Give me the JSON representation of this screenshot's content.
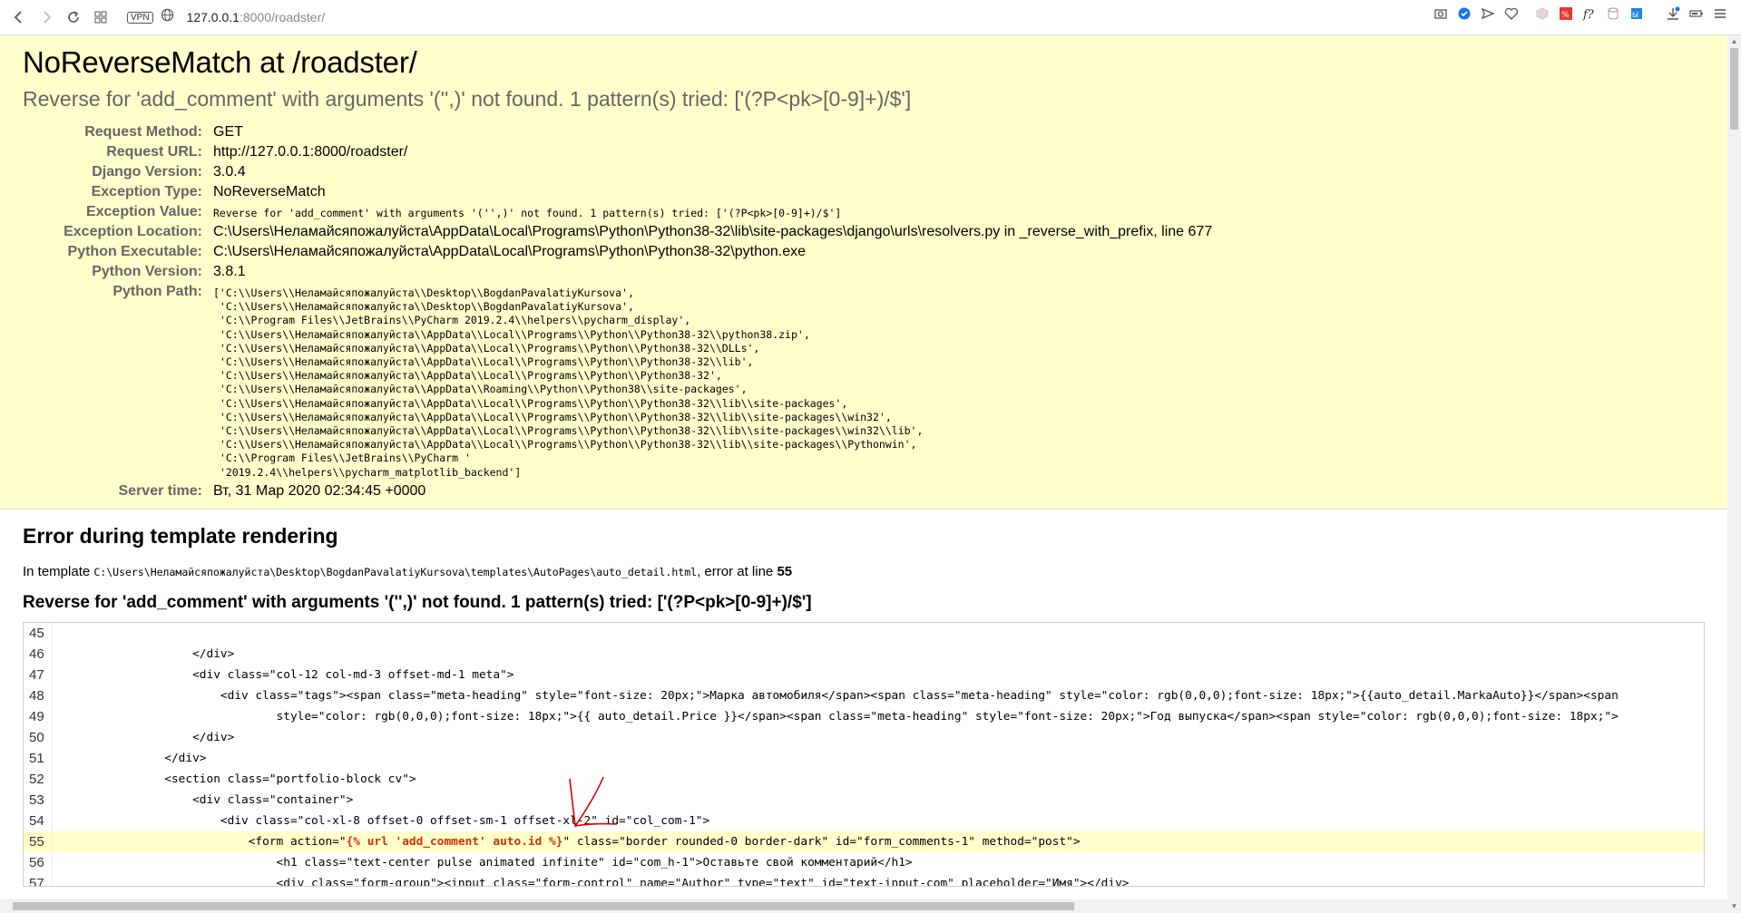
{
  "browser": {
    "url_host": "127.0.0.1",
    "url_rest": ":8000/roadster/",
    "vpn_label": "VPN"
  },
  "error": {
    "title": "NoReverseMatch at /roadster/",
    "subtitle": "Reverse for 'add_comment' with arguments '('',)' not found. 1 pattern(s) tried: ['(?P<pk>[0-9]+)/$']",
    "meta": [
      {
        "label": "Request Method:",
        "value": "GET"
      },
      {
        "label": "Request URL:",
        "value": "http://127.0.0.1:8000/roadster/"
      },
      {
        "label": "Django Version:",
        "value": "3.0.4"
      },
      {
        "label": "Exception Type:",
        "value": "NoReverseMatch"
      },
      {
        "label": "Exception Value:",
        "value": "Reverse for 'add_comment' with arguments '('',)' not found. 1 pattern(s) tried: ['(?P<pk>[0-9]+)/$']"
      },
      {
        "label": "Exception Location:",
        "value": "C:\\Users\\Неламайсяпожалуйста\\AppData\\Local\\Programs\\Python\\Python38-32\\lib\\site-packages\\django\\urls\\resolvers.py in _reverse_with_prefix, line 677"
      },
      {
        "label": "Python Executable:",
        "value": "C:\\Users\\Неламайсяпожалуйста\\AppData\\Local\\Programs\\Python\\Python38-32\\python.exe"
      },
      {
        "label": "Python Version:",
        "value": "3.8.1"
      },
      {
        "label": "Python Path:",
        "value": "['C:\\\\Users\\\\Неламайсяпожалуйста\\\\Desktop\\\\BogdanPavalatiyKursova',\n 'C:\\\\Users\\\\Неламайсяпожалуйста\\\\Desktop\\\\BogdanPavalatiyKursova',\n 'C:\\\\Program Files\\\\JetBrains\\\\PyCharm 2019.2.4\\\\helpers\\\\pycharm_display',\n 'C:\\\\Users\\\\Неламайсяпожалуйста\\\\AppData\\\\Local\\\\Programs\\\\Python\\\\Python38-32\\\\python38.zip',\n 'C:\\\\Users\\\\Неламайсяпожалуйста\\\\AppData\\\\Local\\\\Programs\\\\Python\\\\Python38-32\\\\DLLs',\n 'C:\\\\Users\\\\Неламайсяпожалуйста\\\\AppData\\\\Local\\\\Programs\\\\Python\\\\Python38-32\\\\lib',\n 'C:\\\\Users\\\\Неламайсяпожалуйста\\\\AppData\\\\Local\\\\Programs\\\\Python\\\\Python38-32',\n 'C:\\\\Users\\\\Неламайсяпожалуйста\\\\AppData\\\\Roaming\\\\Python\\\\Python38\\\\site-packages',\n 'C:\\\\Users\\\\Неламайсяпожалуйста\\\\AppData\\\\Local\\\\Programs\\\\Python\\\\Python38-32\\\\lib\\\\site-packages',\n 'C:\\\\Users\\\\Неламайсяпожалуйста\\\\AppData\\\\Local\\\\Programs\\\\Python\\\\Python38-32\\\\lib\\\\site-packages\\\\win32',\n 'C:\\\\Users\\\\Неламайсяпожалуйста\\\\AppData\\\\Local\\\\Programs\\\\Python\\\\Python38-32\\\\lib\\\\site-packages\\\\win32\\\\lib',\n 'C:\\\\Users\\\\Неламайсяпожалуйста\\\\AppData\\\\Local\\\\Programs\\\\Python\\\\Python38-32\\\\lib\\\\site-packages\\\\Pythonwin',\n 'C:\\\\Program Files\\\\JetBrains\\\\PyCharm '\n '2019.2.4\\\\helpers\\\\pycharm_matplotlib_backend']"
      },
      {
        "label": "Server time:",
        "value": "Вт, 31 Мар 2020 02:34:45 +0000"
      }
    ]
  },
  "template": {
    "heading": "Error during template rendering",
    "intro_prefix": "In template ",
    "path": "C:\\Users\\Неламайсяпожалуйста\\Desktop\\BogdanPavalatiyKursova\\templates\\AutoPages\\auto_detail.html",
    "intro_mid": ", error at line ",
    "line": "55",
    "error_msg": "Reverse for 'add_comment' with arguments '('',)' not found. 1 pattern(s) tried: ['(?P<pk>[0-9]+)/$']",
    "source": [
      {
        "num": "45",
        "code": ""
      },
      {
        "num": "46",
        "code": "                    </div>"
      },
      {
        "num": "47",
        "code": "                    <div class=\"col-12 col-md-3 offset-md-1 meta\">"
      },
      {
        "num": "48",
        "code": "                        <div class=\"tags\"><span class=\"meta-heading\" style=\"font-size: 20px;\">Марка автомобиля</span><span class=\"meta-heading\" style=\"color: rgb(0,0,0);font-size: 18px;\">{{auto_detail.MarkaAuto}}</span><span"
      },
      {
        "num": "49",
        "code": "                                style=\"color: rgb(0,0,0);font-size: 18px;\">{{ auto_detail.Price }}</span><span class=\"meta-heading\" style=\"font-size: 20px;\">Год выпуска</span><span style=\"color: rgb(0,0,0);font-size: 18px;\">"
      },
      {
        "num": "50",
        "code": "                    </div>"
      },
      {
        "num": "51",
        "code": "                </div>"
      },
      {
        "num": "52",
        "code": "                <section class=\"portfolio-block cv\">"
      },
      {
        "num": "53",
        "code": "                    <div class=\"container\">"
      },
      {
        "num": "54",
        "code": "                        <div class=\"col-xl-8 offset-0 offset-sm-1 offset-xl-2\" id=\"col_com-1\">"
      },
      {
        "num": "55",
        "code_pre": "                            <form action=\"",
        "code_hl": "{% url 'add_comment' auto.id %}",
        "code_post": "\" class=\"border rounded-0 border-dark\" id=\"form_comments-1\" method=\"post\">"
      },
      {
        "num": "56",
        "code": "                                <h1 class=\"text-center pulse animated infinite\" id=\"com_h-1\">Оставьте свой комментарий</h1>"
      },
      {
        "num": "57",
        "code": "                                <div class=\"form-group\"><input class=\"form-control\" name=\"Author\" type=\"text\" id=\"text-input-com\" placeholder=\"Имя\"></div>"
      }
    ]
  },
  "colors": {
    "summary_bg": "#ffffcc",
    "highlight": "#cc3300",
    "annotation_arrow": "#e00000"
  }
}
